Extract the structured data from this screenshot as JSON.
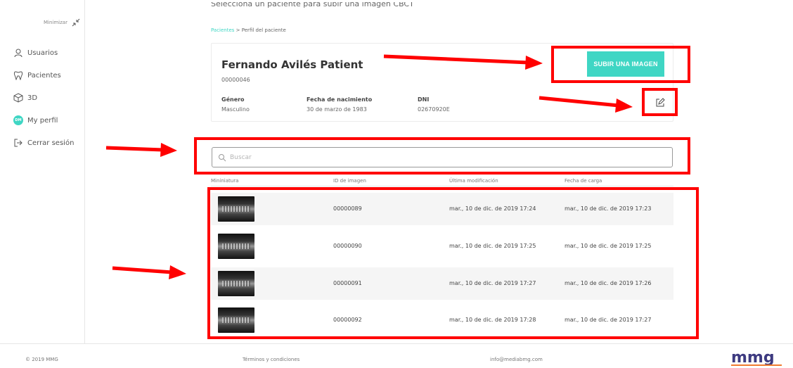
{
  "sidebar": {
    "minimize_label": "Minimizar",
    "items": [
      {
        "label": "Usuarios",
        "icon": "user-icon"
      },
      {
        "label": "Pacientes",
        "icon": "tooth-icon"
      },
      {
        "label": "3D",
        "icon": "cube-icon"
      },
      {
        "label": "My perfil",
        "icon": "avatar-icon",
        "badge": "DM"
      },
      {
        "label": "Cerrar sesión",
        "icon": "logout-icon"
      }
    ]
  },
  "main": {
    "top_text": "Selecciona un paciente para subir una imagen CBCT",
    "breadcrumb": {
      "link": "Pacientes",
      "separator": ">",
      "current": "Perfil del paciente"
    }
  },
  "patient": {
    "name": "Fernando Avilés Patient",
    "id": "00000046",
    "fields": [
      {
        "label": "Género",
        "value": "Masculino"
      },
      {
        "label": "Fecha de nacimiento",
        "value": "30 de marzo de 1983"
      },
      {
        "label": "DNI",
        "value": "02670920E"
      }
    ],
    "upload_button": "SUBIR UNA IMAGEN"
  },
  "search": {
    "placeholder": "Buscar"
  },
  "table": {
    "headers": [
      "Mininiatura",
      "ID de imagen",
      "Última modificación",
      "Fecha de carga"
    ],
    "rows": [
      {
        "id": "00000089",
        "modified": "mar., 10 de dic. de 2019 17:24",
        "uploaded": "mar., 10 de dic. de 2019 17:23"
      },
      {
        "id": "00000090",
        "modified": "mar., 10 de dic. de 2019 17:25",
        "uploaded": "mar., 10 de dic. de 2019 17:25"
      },
      {
        "id": "00000091",
        "modified": "mar., 10 de dic. de 2019 17:27",
        "uploaded": "mar., 10 de dic. de 2019 17:26"
      },
      {
        "id": "00000092",
        "modified": "mar., 10 de dic. de 2019 17:28",
        "uploaded": "mar., 10 de dic. de 2019 17:27"
      }
    ]
  },
  "footer": {
    "copyright": "© 2019 MMG",
    "terms": "Términos y condiciones",
    "email": "info@mediabmg.com",
    "logo_text": "mmg"
  },
  "colors": {
    "accent": "#3fd6c4",
    "annotation": "#ff0000"
  }
}
